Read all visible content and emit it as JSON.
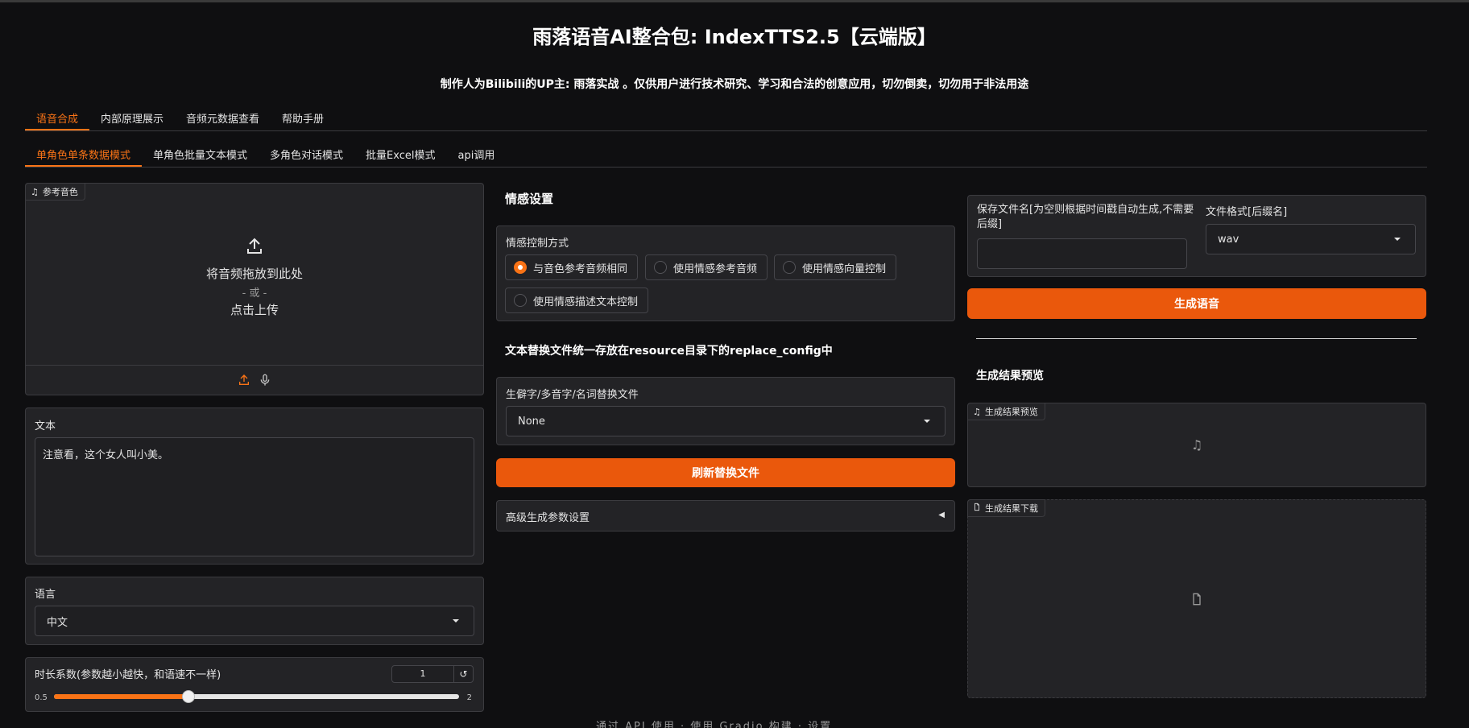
{
  "header": {
    "title": "雨落语音AI整合包: IndexTTS2.5【云端版】",
    "subtitle": "制作人为Bilibili的UP主: 雨落实战 。仅供用户进行技术研究、学习和合法的创意应用，切勿倒卖，切勿用于非法用途"
  },
  "main_tabs": [
    "语音合成",
    "内部原理展示",
    "音频元数据查看",
    "帮助手册"
  ],
  "sub_tabs": [
    "单角色单条数据模式",
    "单角色批量文本模式",
    "多角色对话模式",
    "批量Excel模式",
    "api调用"
  ],
  "left": {
    "ref_audio": {
      "badge": "参考音色",
      "drop_text": "将音频拖放到此处",
      "or_text": "- 或 -",
      "click_text": "点击上传"
    },
    "text": {
      "label": "文本",
      "value": "注意看，这个女人叫小美。"
    },
    "language": {
      "label": "语言",
      "value": "中文"
    },
    "duration": {
      "label": "时长系数(参数越小越快，和语速不一样)",
      "value": "1",
      "min": "0.5",
      "max": "2",
      "fraction": 0.333
    }
  },
  "middle": {
    "emotion_heading": "情感设置",
    "emotion_control_label": "情感控制方式",
    "emotion_options": [
      "与音色参考音频相同",
      "使用情感参考音频",
      "使用情感向量控制",
      "使用情感描述文本控制"
    ],
    "replace_heading": "文本替换文件统一存放在resource目录下的replace_config中",
    "replace_file_label": "生僻字/多音字/名词替换文件",
    "replace_file_value": "None",
    "refresh_button": "刷新替换文件",
    "advanced_label": "高级生成参数设置"
  },
  "right": {
    "filename_label": "保存文件名[为空则根据时间戳自动生成,不需要后缀]",
    "filename_value": "",
    "format_label": "文件格式[后缀名]",
    "format_value": "wav",
    "generate_button": "生成语音",
    "preview_heading": "生成结果预览",
    "preview_badge": "生成结果预览",
    "download_badge": "生成结果下载"
  },
  "footer": "通过 API 使用 · 使用 Gradio 构建 · 设置"
}
